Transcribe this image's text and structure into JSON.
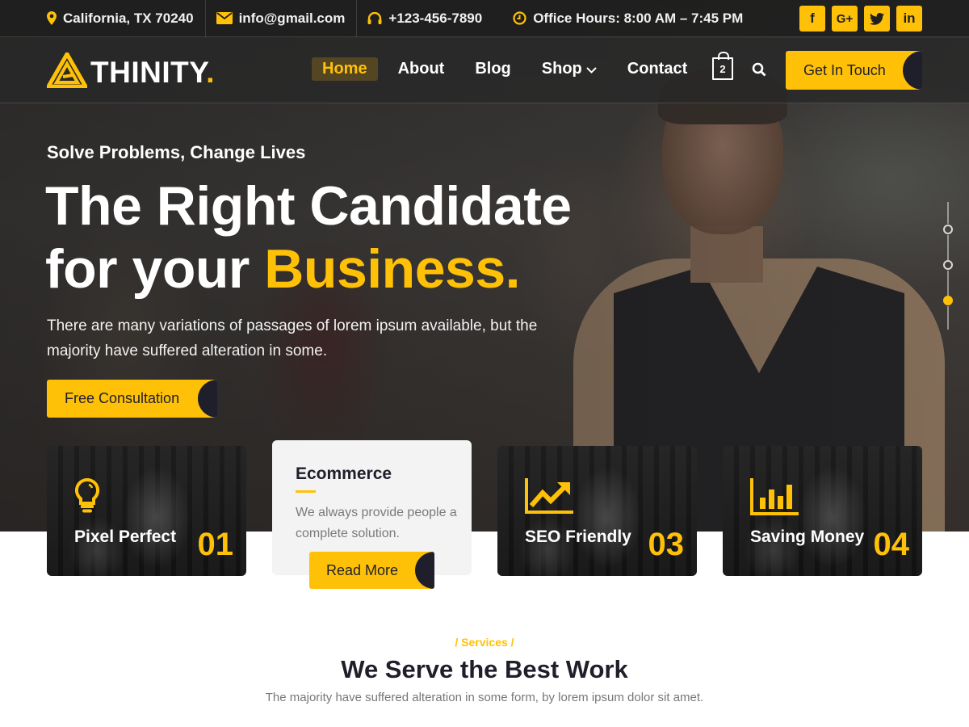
{
  "colors": {
    "accent": "#ffc107",
    "dark": "#1f1f2c",
    "topbar_bg": "#1e1e1e"
  },
  "topbar": {
    "address": "California, TX 70240",
    "email": "info@gmail.com",
    "phone": "+123-456-7890",
    "hours": "Office Hours: 8:00 AM – 7:45 PM",
    "social": [
      {
        "name": "facebook",
        "glyph": "f"
      },
      {
        "name": "google-plus",
        "glyph": "G+"
      },
      {
        "name": "twitter",
        "glyph": "t"
      },
      {
        "name": "linkedin",
        "glyph": "in"
      }
    ]
  },
  "nav": {
    "logo": "THINITY",
    "logo_dot": ".",
    "items": [
      {
        "label": "Home",
        "active": true
      },
      {
        "label": "About"
      },
      {
        "label": "Blog"
      },
      {
        "label": "Shop",
        "has_dropdown": true
      },
      {
        "label": "Contact"
      }
    ],
    "cart_count": "2",
    "cta": "Get In Touch"
  },
  "hero": {
    "kicker": "Solve Problems, Change Lives",
    "title_line1": "The Right Candidate",
    "title_line2_prefix": "for your ",
    "title_highlight": "Business.",
    "lead": "There are many variations of passages of lorem ipsum available, but the majority have suffered alteration in some.",
    "cta": "Free Consultation",
    "slider": {
      "total": 3,
      "active": 3
    }
  },
  "features": [
    {
      "icon": "lightbulb",
      "title": "Pixel Perfect",
      "number": "01"
    },
    {
      "title": "Ecommerce",
      "text": "We always provide people a complete solution.",
      "button": "Read More"
    },
    {
      "icon": "growth-chart",
      "title": "SEO Friendly",
      "number": "03"
    },
    {
      "icon": "bar-chart",
      "title": "Saving Money",
      "number": "04"
    }
  ],
  "services": {
    "kicker": "/ Services /",
    "title": "We Serve the Best Work",
    "subtitle": "The majority have suffered alteration in some form, by lorem ipsum dolor sit amet."
  }
}
